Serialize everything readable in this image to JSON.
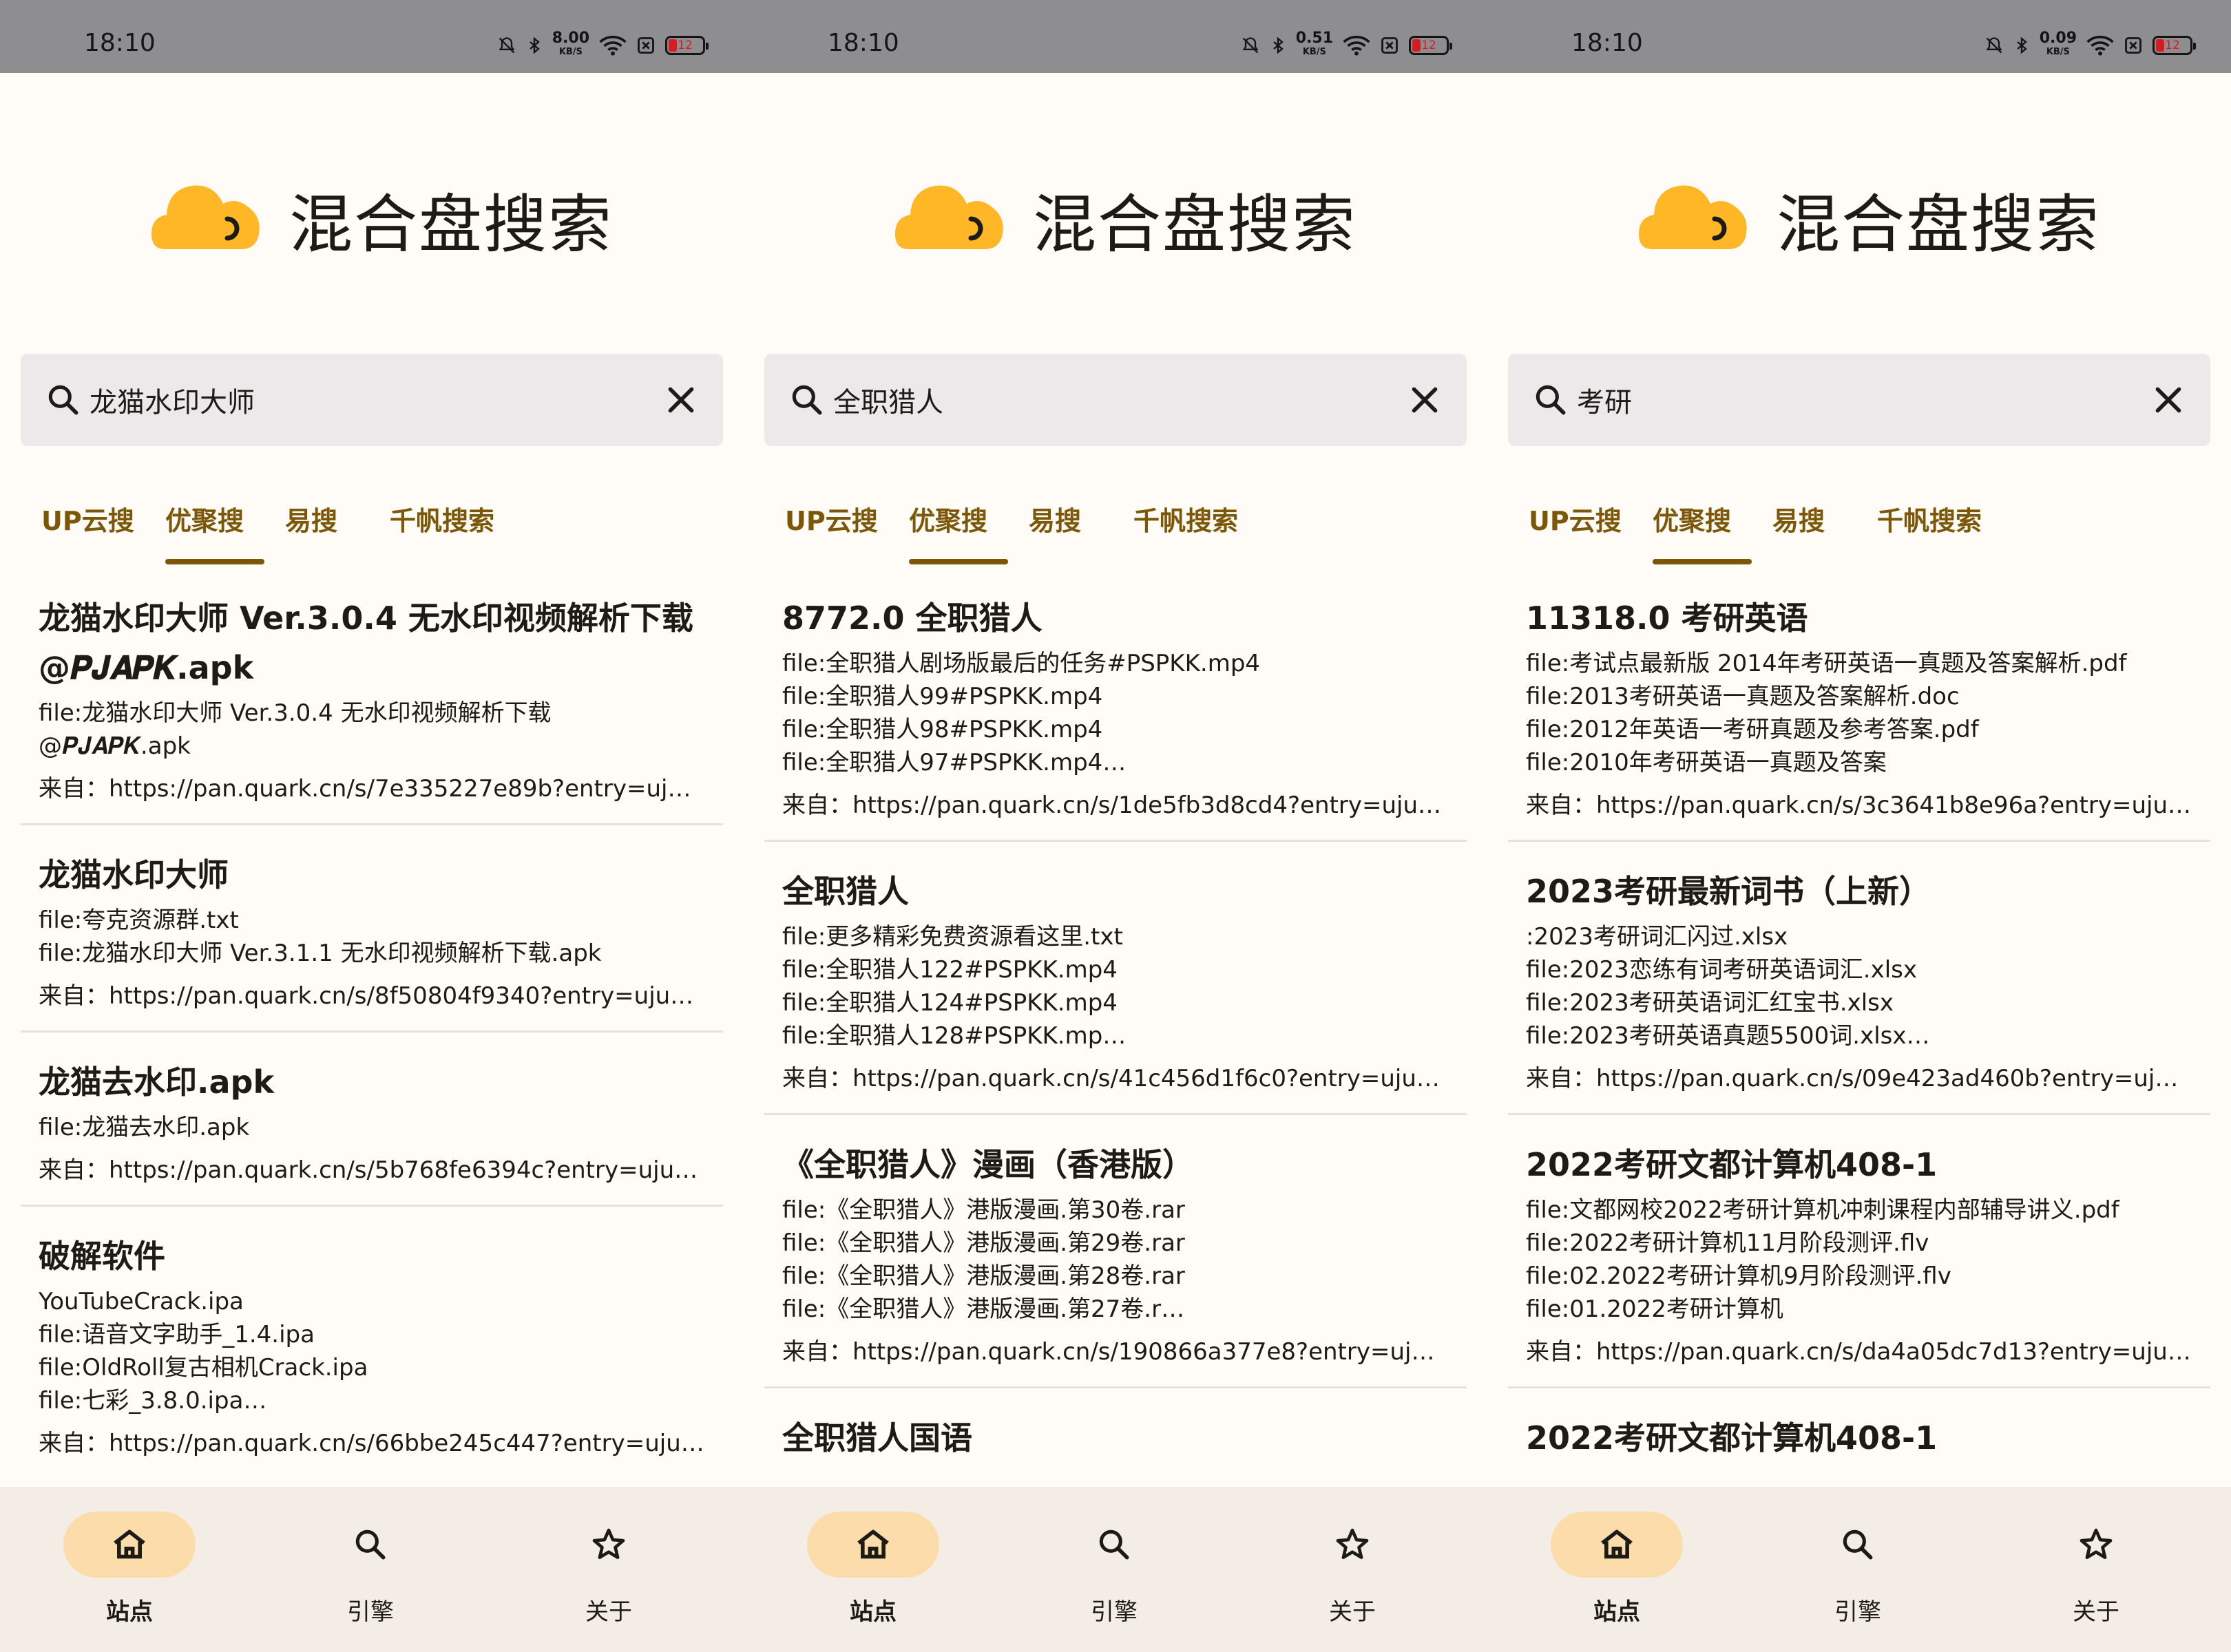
{
  "colors": {
    "accent": "#7b5707",
    "logo": "#ffb728",
    "status_bar": "#8e8d8f",
    "nav_bg": "#f3ede6",
    "nav_active": "#fbdcaa",
    "search_bg": "#ebe9ea"
  },
  "app_title": "混合盘搜索",
  "screens": [
    {
      "status": {
        "time": "18:10",
        "speed": "8.00",
        "speed_unit": "KB/S",
        "battery": "12"
      },
      "search": {
        "query": "龙猫水印大师"
      },
      "tabs": [
        {
          "label": "UP云搜"
        },
        {
          "label": "优聚搜"
        },
        {
          "label": "易搜"
        },
        {
          "label": "千帆搜索"
        }
      ],
      "active_tab": 1,
      "results": [
        {
          "title": "龙猫水印大师 Ver.3.0.4 无水印视频解析下载 @𝑷𝑱𝑨𝑷𝑲.apk",
          "lines": [
            "file:龙猫水印大师 Ver.3.0.4 无水印视频解析下载",
            "@𝑷𝑱𝑨𝑷𝑲.apk"
          ],
          "source": "来自：https://pan.quark.cn/s/7e335227e89b?entry=uju…"
        },
        {
          "title": "龙猫水印大师",
          "lines": [
            "file:夸克资源群.txt",
            "file:龙猫水印大师 Ver.3.1.1 无水印视频解析下载.apk"
          ],
          "source": "来自：https://pan.quark.cn/s/8f50804f9340?entry=uju…"
        },
        {
          "title": "龙猫去水印.apk",
          "lines": [
            "file:龙猫去水印.apk"
          ],
          "source": "来自：https://pan.quark.cn/s/5b768fe6394c?entry=uju…"
        },
        {
          "title": "破解软件",
          "lines": [
            "YouTubeCrack.ipa",
            "file:语音文字助手_1.4.ipa",
            "file:OldRoll复古相机Crack.ipa",
            "file:七彩_3.8.0.ipa…"
          ],
          "source": "来自：https://pan.quark.cn/s/66bbe245c447?entry=uju…"
        }
      ]
    },
    {
      "status": {
        "time": "18:10",
        "speed": "0.51",
        "speed_unit": "KB/S",
        "battery": "12"
      },
      "search": {
        "query": "全职猎人"
      },
      "tabs": [
        {
          "label": "UP云搜"
        },
        {
          "label": "优聚搜"
        },
        {
          "label": "易搜"
        },
        {
          "label": "千帆搜索"
        }
      ],
      "active_tab": 1,
      "results": [
        {
          "title": "8772.0 全职猎人",
          "lines": [
            "file:全职猎人剧场版最后的任务#PSPKK.mp4",
            "file:全职猎人99#PSPKK.mp4",
            "file:全职猎人98#PSPKK.mp4",
            "file:全职猎人97#PSPKK.mp4…"
          ],
          "source": "来自：https://pan.quark.cn/s/1de5fb3d8cd4?entry=uju…"
        },
        {
          "title": "全职猎人",
          "lines": [
            "file:更多精彩免费资源看这里.txt",
            "file:全职猎人122#PSPKK.mp4",
            "file:全职猎人124#PSPKK.mp4",
            "file:全职猎人128#PSPKK.mp…"
          ],
          "source": "来自：https://pan.quark.cn/s/41c456d1f6c0?entry=uju…"
        },
        {
          "title": "《全职猎人》漫画（香港版）",
          "lines": [
            "file:《全职猎人》港版漫画.第30卷.rar",
            "file:《全职猎人》港版漫画.第29卷.rar",
            "file:《全职猎人》港版漫画.第28卷.rar",
            "file:《全职猎人》港版漫画.第27卷.r…"
          ],
          "source": "来自：https://pan.quark.cn/s/190866a377e8?entry=uju…"
        },
        {
          "title": "全职猎人国语",
          "lines": [],
          "source": ""
        }
      ]
    },
    {
      "status": {
        "time": "18:10",
        "speed": "0.09",
        "speed_unit": "KB/S",
        "battery": "12"
      },
      "search": {
        "query": "考研"
      },
      "tabs": [
        {
          "label": "UP云搜"
        },
        {
          "label": "优聚搜"
        },
        {
          "label": "易搜"
        },
        {
          "label": "千帆搜索"
        }
      ],
      "active_tab": 1,
      "results": [
        {
          "title": "11318.0 考研英语",
          "lines": [
            "file:考试点最新版 2014年考研英语一真题及答案解析.pdf",
            "file:2013考研英语一真题及答案解析.doc",
            "file:2012年英语一考研真题及参考答案.pdf",
            "file:2010年考研英语一真题及答案"
          ],
          "source": "来自：https://pan.quark.cn/s/3c3641b8e96a?entry=uju…"
        },
        {
          "title": "2023考研最新词书（上新）",
          "lines": [
            ":2023考研词汇闪过.xlsx",
            "file:2023恋练有词考研英语词汇.xlsx",
            "file:2023考研英语词汇红宝书.xlsx",
            "file:2023考研英语真题5500词.xlsx…"
          ],
          "source": "来自：https://pan.quark.cn/s/09e423ad460b?entry=uju…"
        },
        {
          "title": "2022考研文都计算机408-1",
          "lines": [
            "file:文都网校2022考研计算机冲刺课程内部辅导讲义.pdf",
            "file:2022考研计算机11月阶段测评.flv",
            "file:02.2022考研计算机9月阶段测评.flv",
            "file:01.2022考研计算机"
          ],
          "source": "来自：https://pan.quark.cn/s/da4a05dc7d13?entry=uju…"
        },
        {
          "title": "2022考研文都计算机408-1",
          "lines": [],
          "source": ""
        }
      ]
    }
  ],
  "nav": [
    {
      "label": "站点",
      "icon": "home-icon"
    },
    {
      "label": "引擎",
      "icon": "search-icon"
    },
    {
      "label": "关于",
      "icon": "star-icon"
    }
  ],
  "nav_active": 0
}
